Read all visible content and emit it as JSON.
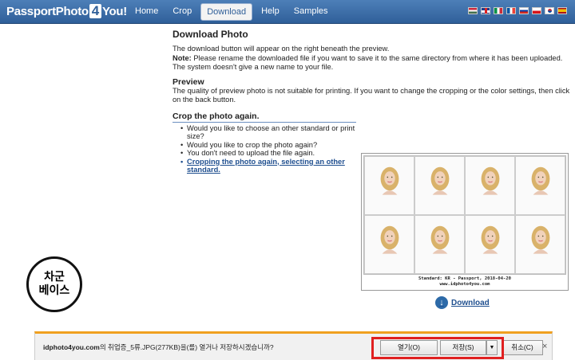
{
  "navbar": {
    "logo": {
      "part1": "PassportPhoto",
      "part2": "4",
      "part3": "You!"
    },
    "items": [
      {
        "label": "Home",
        "active": false
      },
      {
        "label": "Crop",
        "active": false
      },
      {
        "label": "Download",
        "active": true
      },
      {
        "label": "Help",
        "active": false
      },
      {
        "label": "Samples",
        "active": false
      }
    ],
    "flags": [
      "hungary-flag-icon",
      "uk-flag-icon",
      "italy-flag-icon",
      "france-flag-icon",
      "russia-flag-icon",
      "czech-flag-icon",
      "korea-flag-icon",
      "spain-flag-icon"
    ]
  },
  "content": {
    "title": "Download Photo",
    "intro": "The download button will appear on the right beneath the preview.",
    "note_label": "Note:",
    "note_text": " Please rename the downloaded file if you want to save it to the same directory from where it has been uploaded. The system doesn't give a new name to your file.",
    "preview_heading": "Preview",
    "preview_text": "The quality of preview photo is not suitable for printing. If you want to change the cropping or the color settings, then click on the back button.",
    "crop_heading": "Crop the photo again.",
    "crop_items": [
      "Would you like to choose an other standard or print size?",
      "Would you like to crop the photo again?",
      "You don't need to upload the file again."
    ],
    "crop_link": "Cropping the photo again, selecting an other standard."
  },
  "sheet": {
    "caption_line1": "Standard: KR - Passport, 2018-04-20",
    "caption_line2": "www.idphoto4you.com",
    "download_label": "Download"
  },
  "watermark": {
    "line1": "차군",
    "line2": "베이스"
  },
  "download_bar": {
    "site": "idphoto4you.com",
    "message": "의 취업증_5류.JPG(277KB)을(를) 열거나 저장하시겠습니까?",
    "open_label": "열기(O)",
    "save_label": "저장(S)",
    "save_arrow": "▼",
    "cancel_label": "취소(C)",
    "close_label": "×"
  },
  "colors": {
    "navbar": "#2f5f99",
    "highlight": "#e02020",
    "bar_accent": "#f0a020"
  }
}
